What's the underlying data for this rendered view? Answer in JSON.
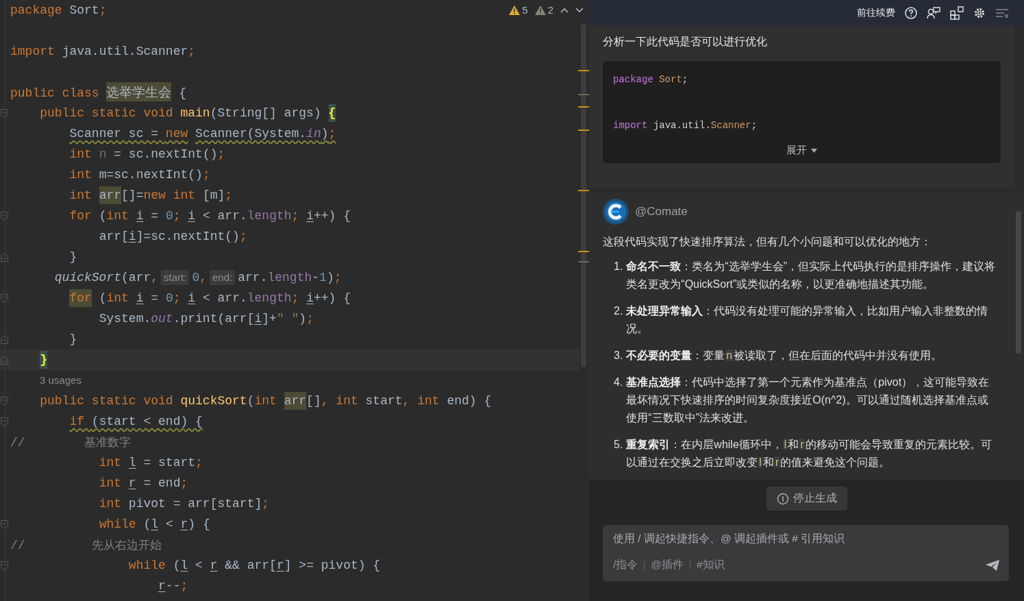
{
  "editor": {
    "inspections": [
      {
        "kind": "warning",
        "count": "5"
      },
      {
        "kind": "weak",
        "count": "2"
      }
    ],
    "lines": [
      {
        "kind": "code",
        "tokens": [
          {
            "text": "package",
            "kind": "kw"
          },
          {
            "text": " Sort",
            "kind": "plain"
          },
          {
            "text": ";",
            "kind": "punct"
          }
        ]
      },
      {
        "kind": "blank"
      },
      {
        "kind": "code",
        "tokens": [
          {
            "text": "import",
            "kind": "kw"
          },
          {
            "text": " java.util.Scanner",
            "kind": "plain"
          },
          {
            "text": ";",
            "kind": "punct"
          }
        ]
      },
      {
        "kind": "blank"
      },
      {
        "kind": "code",
        "tokens": [
          {
            "text": "public class ",
            "kind": "kw"
          },
          {
            "text": "选举学生会",
            "kind": "marked-cjk"
          },
          {
            "text": " {",
            "kind": "plain"
          }
        ]
      },
      {
        "kind": "code",
        "fold": {
          "kind": "start"
        },
        "tokens": [
          {
            "text": "    public static void ",
            "kind": "kw"
          },
          {
            "text": "main",
            "kind": "method"
          },
          {
            "text": "(String[] args) ",
            "kind": "plain"
          },
          {
            "text": "{",
            "kind": "brace"
          }
        ]
      },
      {
        "kind": "warning",
        "tokens": [
          {
            "text": "        Scanner sc = ",
            "kind": "plain"
          },
          {
            "text": "new",
            "kind": "kw"
          },
          {
            "text": " Scanner(System.",
            "kind": "plain"
          },
          {
            "text": "in",
            "kind": "static"
          },
          {
            "text": ")",
            "kind": "plain"
          },
          {
            "text": ";",
            "kind": "punct"
          }
        ]
      },
      {
        "kind": "code",
        "tokens": [
          {
            "text": "        int ",
            "kind": "kw"
          },
          {
            "text": "n",
            "kind": "unused"
          },
          {
            "text": " = sc.nextInt()",
            "kind": "plain"
          },
          {
            "text": ";",
            "kind": "punct"
          }
        ]
      },
      {
        "kind": "code",
        "tokens": [
          {
            "text": "        int ",
            "kind": "kw"
          },
          {
            "text": "m=sc.nextInt()",
            "kind": "plain"
          },
          {
            "text": ";",
            "kind": "punct"
          }
        ]
      },
      {
        "kind": "code",
        "tokens": [
          {
            "text": "        int ",
            "kind": "kw"
          },
          {
            "text": "arr",
            "kind": "marked"
          },
          {
            "text": "[]=",
            "kind": "plain"
          },
          {
            "text": "new int ",
            "kind": "kw"
          },
          {
            "text": "[m]",
            "kind": "plain"
          },
          {
            "text": ";",
            "kind": "punct"
          }
        ]
      },
      {
        "kind": "code",
        "fold": {
          "kind": "start"
        },
        "tokens": [
          {
            "text": "        for ",
            "kind": "kw"
          },
          {
            "text": "(",
            "kind": "plain"
          },
          {
            "text": "int ",
            "kind": "kw"
          },
          {
            "text": "i",
            "kind": "var"
          },
          {
            "text": " = ",
            "kind": "plain"
          },
          {
            "text": "0",
            "kind": "num"
          },
          {
            "text": "; ",
            "kind": "punct"
          },
          {
            "text": "i",
            "kind": "var"
          },
          {
            "text": " < arr.",
            "kind": "plain"
          },
          {
            "text": "length",
            "kind": "field"
          },
          {
            "text": "; ",
            "kind": "punct"
          },
          {
            "text": "i",
            "kind": "var"
          },
          {
            "text": "++) {",
            "kind": "plain"
          }
        ]
      },
      {
        "kind": "code",
        "tokens": [
          {
            "text": "            arr[",
            "kind": "plain"
          },
          {
            "text": "i",
            "kind": "var"
          },
          {
            "text": "]=sc.nextInt()",
            "kind": "plain"
          },
          {
            "text": ";",
            "kind": "punct"
          }
        ]
      },
      {
        "kind": "code",
        "fold": {
          "kind": "end"
        },
        "tokens": [
          {
            "text": "        }",
            "kind": "plain"
          }
        ]
      },
      {
        "kind": "code",
        "tokens": [
          {
            "text": "      quickSort",
            "kind": "call"
          },
          {
            "text": "(arr",
            "kind": "plain"
          },
          {
            "text": ",",
            "kind": "punct"
          },
          {
            "text": "start:",
            "kind": "hint"
          },
          {
            "text": "0",
            "kind": "num"
          },
          {
            "text": ",",
            "kind": "punct"
          },
          {
            "text": "end:",
            "kind": "hint"
          },
          {
            "text": "arr.",
            "kind": "plain"
          },
          {
            "text": "length",
            "kind": "field"
          },
          {
            "text": "-",
            "kind": "plain"
          },
          {
            "text": "1",
            "kind": "num"
          },
          {
            "text": ")",
            "kind": "plain"
          },
          {
            "text": ";",
            "kind": "punct"
          }
        ]
      },
      {
        "kind": "code",
        "fold": {
          "kind": "start"
        },
        "tokens": [
          {
            "text": "        for",
            "kind": "marked-kw"
          },
          {
            "text": " (",
            "kind": "plain"
          },
          {
            "text": "int ",
            "kind": "kw"
          },
          {
            "text": "i",
            "kind": "var"
          },
          {
            "text": " = ",
            "kind": "plain"
          },
          {
            "text": "0",
            "kind": "num"
          },
          {
            "text": "; ",
            "kind": "punct"
          },
          {
            "text": "i",
            "kind": "var"
          },
          {
            "text": " < arr.",
            "kind": "plain"
          },
          {
            "text": "length",
            "kind": "field"
          },
          {
            "text": "; ",
            "kind": "punct"
          },
          {
            "text": "i",
            "kind": "var"
          },
          {
            "text": "++) {",
            "kind": "plain"
          }
        ]
      },
      {
        "kind": "code",
        "tokens": [
          {
            "text": "            System.",
            "kind": "plain"
          },
          {
            "text": "out",
            "kind": "static"
          },
          {
            "text": ".print(arr[",
            "kind": "plain"
          },
          {
            "text": "i",
            "kind": "var"
          },
          {
            "text": "]+",
            "kind": "plain"
          },
          {
            "text": "\" \"",
            "kind": "string"
          },
          {
            "text": ")",
            "kind": "plain"
          },
          {
            "text": ";",
            "kind": "punct"
          }
        ]
      },
      {
        "kind": "code",
        "fold": {
          "kind": "end"
        },
        "tokens": [
          {
            "text": "        }",
            "kind": "plain"
          }
        ]
      },
      {
        "kind": "current",
        "fold": {
          "kind": "end"
        },
        "tokens": [
          {
            "text": "    }",
            "kind": "brace"
          }
        ]
      },
      {
        "kind": "usages",
        "text": "3 usages"
      },
      {
        "kind": "code",
        "fold": {
          "kind": "start"
        },
        "tokens": [
          {
            "text": "    public static void ",
            "kind": "kw"
          },
          {
            "text": "quickSort",
            "kind": "method"
          },
          {
            "text": "(",
            "kind": "plain"
          },
          {
            "text": "int ",
            "kind": "kw"
          },
          {
            "text": "arr",
            "kind": "marked"
          },
          {
            "text": "[]",
            "kind": "plain"
          },
          {
            "text": ", ",
            "kind": "punct"
          },
          {
            "text": "int ",
            "kind": "kw"
          },
          {
            "text": "start",
            "kind": "plain"
          },
          {
            "text": ", ",
            "kind": "punct"
          },
          {
            "text": "int ",
            "kind": "kw"
          },
          {
            "text": "end) {",
            "kind": "plain"
          }
        ]
      },
      {
        "kind": "warning",
        "fold": {
          "kind": "start"
        },
        "tokens": [
          {
            "text": "        if ",
            "kind": "kw"
          },
          {
            "text": "(start < end) {",
            "kind": "plain"
          }
        ]
      },
      {
        "kind": "code",
        "tokens": [
          {
            "text": "//",
            "kind": "comment"
          },
          {
            "text": "        基准数字",
            "kind": "comment-cjk"
          }
        ]
      },
      {
        "kind": "code",
        "tokens": [
          {
            "text": "            int ",
            "kind": "kw"
          },
          {
            "text": "l",
            "kind": "var"
          },
          {
            "text": " = start",
            "kind": "plain"
          },
          {
            "text": ";",
            "kind": "punct"
          }
        ]
      },
      {
        "kind": "code",
        "tokens": [
          {
            "text": "            int ",
            "kind": "kw"
          },
          {
            "text": "r",
            "kind": "var"
          },
          {
            "text": " = end",
            "kind": "plain"
          },
          {
            "text": ";",
            "kind": "punct"
          }
        ]
      },
      {
        "kind": "code",
        "tokens": [
          {
            "text": "            int ",
            "kind": "kw"
          },
          {
            "text": "pivot = arr[start]",
            "kind": "plain"
          },
          {
            "text": ";",
            "kind": "punct"
          }
        ]
      },
      {
        "kind": "code",
        "fold": {
          "kind": "start"
        },
        "tokens": [
          {
            "text": "            while ",
            "kind": "kw"
          },
          {
            "text": "(",
            "kind": "plain"
          },
          {
            "text": "l",
            "kind": "var"
          },
          {
            "text": " < ",
            "kind": "plain"
          },
          {
            "text": "r",
            "kind": "var"
          },
          {
            "text": ") {",
            "kind": "plain"
          }
        ]
      },
      {
        "kind": "code",
        "tokens": [
          {
            "text": "//",
            "kind": "comment"
          },
          {
            "text": "         先从右边开始",
            "kind": "comment-cjk"
          }
        ]
      },
      {
        "kind": "code",
        "fold": {
          "kind": "start"
        },
        "tokens": [
          {
            "text": "                while ",
            "kind": "kw"
          },
          {
            "text": "(",
            "kind": "plain"
          },
          {
            "text": "l",
            "kind": "var"
          },
          {
            "text": " < ",
            "kind": "plain"
          },
          {
            "text": "r",
            "kind": "var"
          },
          {
            "text": " && arr[",
            "kind": "plain"
          },
          {
            "text": "r",
            "kind": "var"
          },
          {
            "text": "] >= pivot) {",
            "kind": "plain"
          }
        ]
      },
      {
        "kind": "code",
        "tokens": [
          {
            "text": "                    r",
            "kind": "var"
          },
          {
            "text": "--",
            "kind": "plain"
          },
          {
            "text": ";",
            "kind": "punct"
          }
        ]
      }
    ]
  },
  "assistant": {
    "renew": "前往续费",
    "question": "分析一下此代码是否可以进行优化",
    "snippet": [
      {
        "kind": "code",
        "tokens": [
          {
            "text": "package",
            "kind": "kw"
          },
          {
            "text": " Sort",
            "kind": "type"
          },
          {
            "text": ";",
            "kind": "plain"
          }
        ]
      },
      {
        "kind": "blank"
      },
      {
        "kind": "code",
        "tokens": [
          {
            "text": "import",
            "kind": "kw"
          },
          {
            "text": " java.util.",
            "kind": "plain"
          },
          {
            "text": "Scanner",
            "kind": "type"
          },
          {
            "text": ";",
            "kind": "plain"
          }
        ]
      }
    ],
    "expand": "展开",
    "bot_name": "@Comate",
    "intro": "这段代码实现了快速排序算法，但有几个小问题和可以优化的地方：",
    "points": [
      {
        "number": "1.",
        "title": "命名不一致",
        "parts": [
          {
            "kind": "text",
            "text": "：类名为“选举学生会”，但实际上代码执行的是排序操作，建议将类名更改为“QuickSort”或类似的名称，以更准确地描述其功能。"
          }
        ]
      },
      {
        "number": "2.",
        "title": "未处理异常输入",
        "parts": [
          {
            "kind": "text",
            "text": "：代码没有处理可能的异常输入，比如用户输入非整数的情况。"
          }
        ]
      },
      {
        "number": "3.",
        "title": "不必要的变量",
        "parts": [
          {
            "kind": "text",
            "text": "：变量"
          },
          {
            "kind": "code",
            "text": "n"
          },
          {
            "kind": "text",
            "text": "被读取了，但在后面的代码中并没有使用。"
          }
        ]
      },
      {
        "number": "4.",
        "title": "基准点选择",
        "parts": [
          {
            "kind": "text",
            "text": "：代码中选择了第一个元素作为基准点（pivot），这可能导致在最坏情况下快速排序的时间复杂度接近O(n^2)。可以通过随机选择基准点或使用“三数取中”法来改进。"
          }
        ]
      },
      {
        "number": "5.",
        "title": "重复索引",
        "parts": [
          {
            "kind": "text",
            "text": "：在内层while循环中，"
          },
          {
            "kind": "code",
            "text": "l"
          },
          {
            "kind": "text",
            "text": "和"
          },
          {
            "kind": "code",
            "text": "r"
          },
          {
            "kind": "text",
            "text": "的移动可能会导致重复的元素比较。可以通过在交换之后立即改变"
          },
          {
            "kind": "code",
            "text": "l"
          },
          {
            "kind": "text",
            "text": "和"
          },
          {
            "kind": "code",
            "text": "r"
          },
          {
            "kind": "text",
            "text": "的值来避免这个问题。"
          }
        ]
      }
    ],
    "stop": "停止生成",
    "input": {
      "placeholder": "使用 / 调起快捷指令、@ 调起插件或 # 引用知识"
    },
    "shortcuts": [
      "/指令",
      "@插件",
      "#知识"
    ]
  }
}
